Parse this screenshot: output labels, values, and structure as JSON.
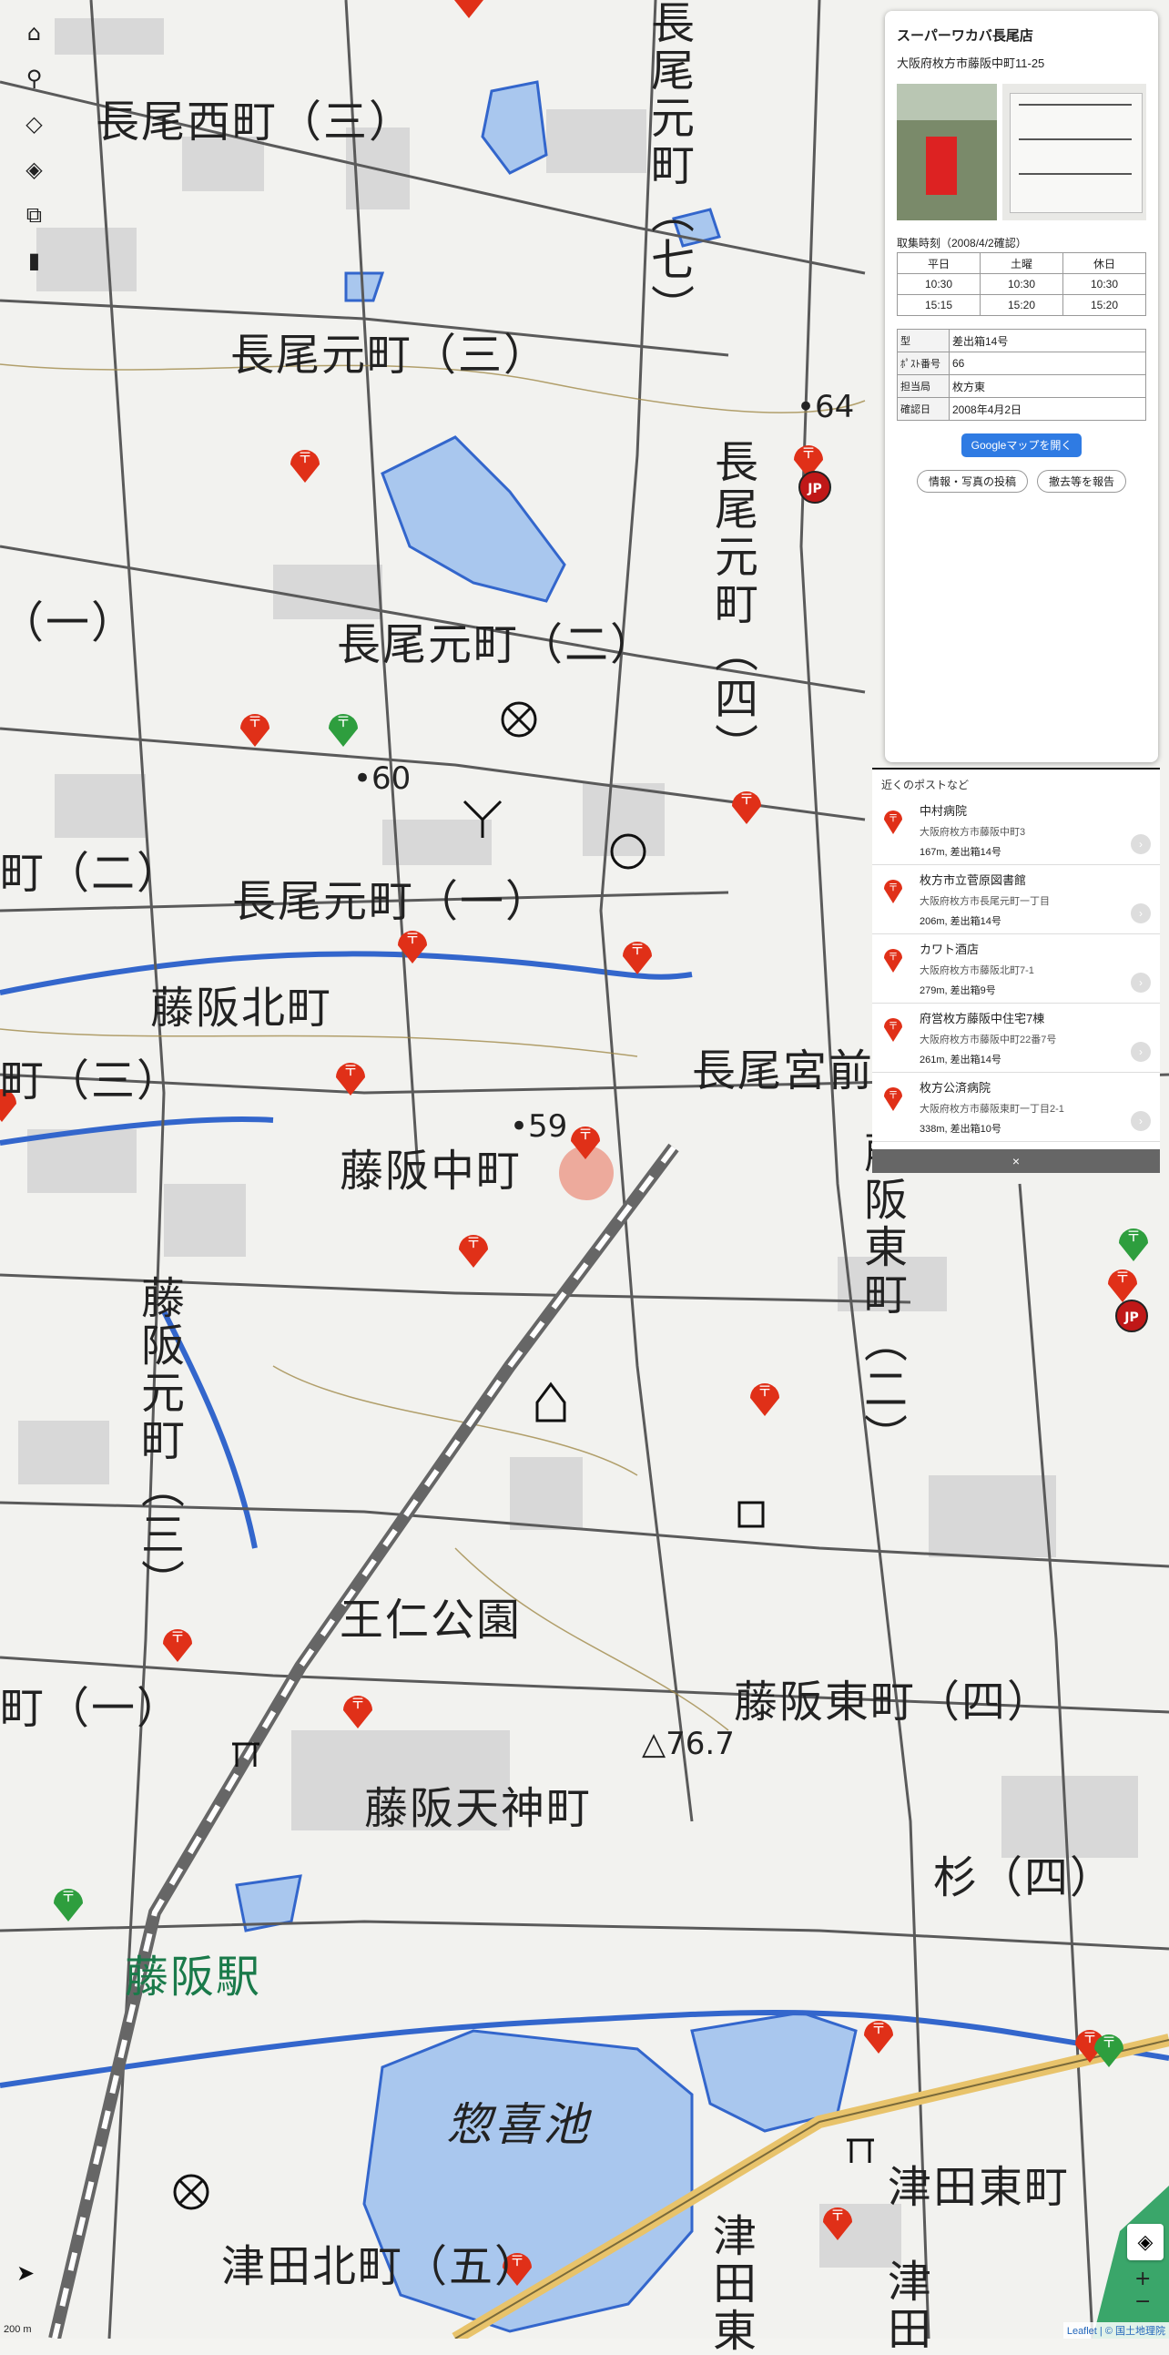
{
  "map": {
    "water_color": "#a9c7ee",
    "road_color": "#5a5a5a",
    "rail_color": "#7a7a7a",
    "red_pin_color": "#e03018",
    "green_pin_color": "#2e9e3e",
    "places": [
      {
        "id": "nagao-nishi-3",
        "text": "長尾西町（三）",
        "cls": "big"
      },
      {
        "id": "nagao-moto-7",
        "text": "長尾元町（七）",
        "cls": "v"
      },
      {
        "id": "nagao-moto-3",
        "text": "長尾元町（三）",
        "cls": "big"
      },
      {
        "id": "nagao-moto-4",
        "text": "長尾元町（四）",
        "cls": "v"
      },
      {
        "id": "nagao-moto-2",
        "text": "長尾元町（二）",
        "cls": "big"
      },
      {
        "id": "nagao-moto-1",
        "text": "長尾元町（一）",
        "cls": "big"
      },
      {
        "id": "left-1a",
        "text": "（一）",
        "cls": "big"
      },
      {
        "id": "left-2",
        "text": "町（二）",
        "cls": "big"
      },
      {
        "id": "fujisaka-kita",
        "text": "藤阪北町",
        "cls": "big"
      },
      {
        "id": "left-3",
        "text": "町（三）",
        "cls": "big"
      },
      {
        "id": "nagao-miya",
        "text": "長尾宮前",
        "cls": "big"
      },
      {
        "id": "fujisaka-naka",
        "text": "藤阪中町",
        "cls": "big"
      },
      {
        "id": "fujisaka-higashi-2",
        "text": "藤阪東町（二）",
        "cls": "v"
      },
      {
        "id": "fujisaka-moto-3",
        "text": "藤阪元町（三）",
        "cls": "v"
      },
      {
        "id": "wani-park",
        "text": "王仁公園",
        "cls": "big"
      },
      {
        "id": "fujisaka-higashi-4",
        "text": "藤阪東町（四）",
        "cls": "big"
      },
      {
        "id": "left-1b",
        "text": "町（一）",
        "cls": "big"
      },
      {
        "id": "fujisaka-tenjin",
        "text": "藤阪天神町",
        "cls": "big"
      },
      {
        "id": "sugi-4",
        "text": "杉（四）",
        "cls": "big"
      },
      {
        "id": "fujisaka-station",
        "text": "藤阪駅",
        "cls": "station"
      },
      {
        "id": "sokiike",
        "text": "惣喜池",
        "cls": "pond"
      },
      {
        "id": "tsuda-higashi",
        "text": "津田東町",
        "cls": "big"
      },
      {
        "id": "tsuda-kita",
        "text": "津田北町（五）",
        "cls": "big"
      },
      {
        "id": "tsuda-v1",
        "text": "津田東",
        "cls": "v"
      },
      {
        "id": "tsuda-v2",
        "text": "津田",
        "cls": "v"
      },
      {
        "id": "elev-64",
        "text": "•64",
        "cls": "elev"
      },
      {
        "id": "elev-60",
        "text": "•60",
        "cls": "elev"
      },
      {
        "id": "elev-59",
        "text": "•59",
        "cls": "elev"
      },
      {
        "id": "elev-76",
        "text": "△76.7",
        "cls": "elev"
      }
    ]
  },
  "toolbar": {
    "items": [
      {
        "name": "home-icon",
        "glyph": "⌂"
      },
      {
        "name": "user-icon",
        "glyph": "⚲"
      },
      {
        "name": "layers-icon",
        "glyph": "◇"
      },
      {
        "name": "layers-alt-icon",
        "glyph": "◈"
      },
      {
        "name": "stack-icon",
        "glyph": "⧉"
      },
      {
        "name": "postbox-icon",
        "glyph": "▮"
      }
    ]
  },
  "info_panel": {
    "title": "スーパーワカバ長尾店",
    "address": "大阪府枚方市藤阪中町11-25",
    "collection_heading": "取集時刻（2008/4/2確認）",
    "collection_headers": [
      "平日",
      "土曜",
      "休日"
    ],
    "collection_rows": [
      [
        "10:30",
        "10:30",
        "10:30"
      ],
      [
        "15:15",
        "15:20",
        "15:20"
      ]
    ],
    "details": [
      {
        "k": "型",
        "v": "差出箱14号"
      },
      {
        "k": "ﾎﾟｽﾄ番号",
        "v": "66"
      },
      {
        "k": "担当局",
        "v": "枚方東"
      },
      {
        "k": "確認日",
        "v": "2008年4月2日"
      }
    ],
    "google_button": "Googleマップを開く",
    "post_info_button": "情報・写真の投稿",
    "report_button": "撤去等を報告"
  },
  "nearby": {
    "heading": "近くのポストなど",
    "items": [
      {
        "name": "中村病院",
        "address": "大阪府枚方市藤阪中町3",
        "meta": "167m, 差出箱14号"
      },
      {
        "name": "枚方市立菅原図書館",
        "address": "大阪府枚方市長尾元町一丁目",
        "meta": "206m, 差出箱14号"
      },
      {
        "name": "カワト酒店",
        "address": "大阪府枚方市藤阪北町7-1",
        "meta": "279m, 差出箱9号"
      },
      {
        "name": "府営枚方藤阪中住宅7棟",
        "address": "大阪府枚方市藤阪中町22番7号",
        "meta": "261m, 差出箱14号"
      },
      {
        "name": "枚方公済病院",
        "address": "大阪府枚方市藤阪東町一丁目2-1",
        "meta": "338m, 差出箱10号"
      }
    ],
    "close_label": "×"
  },
  "controls": {
    "zoom_in": "+",
    "zoom_out": "−",
    "attribution": "Leaflet | © 国土地理院",
    "scale": "200 m"
  }
}
